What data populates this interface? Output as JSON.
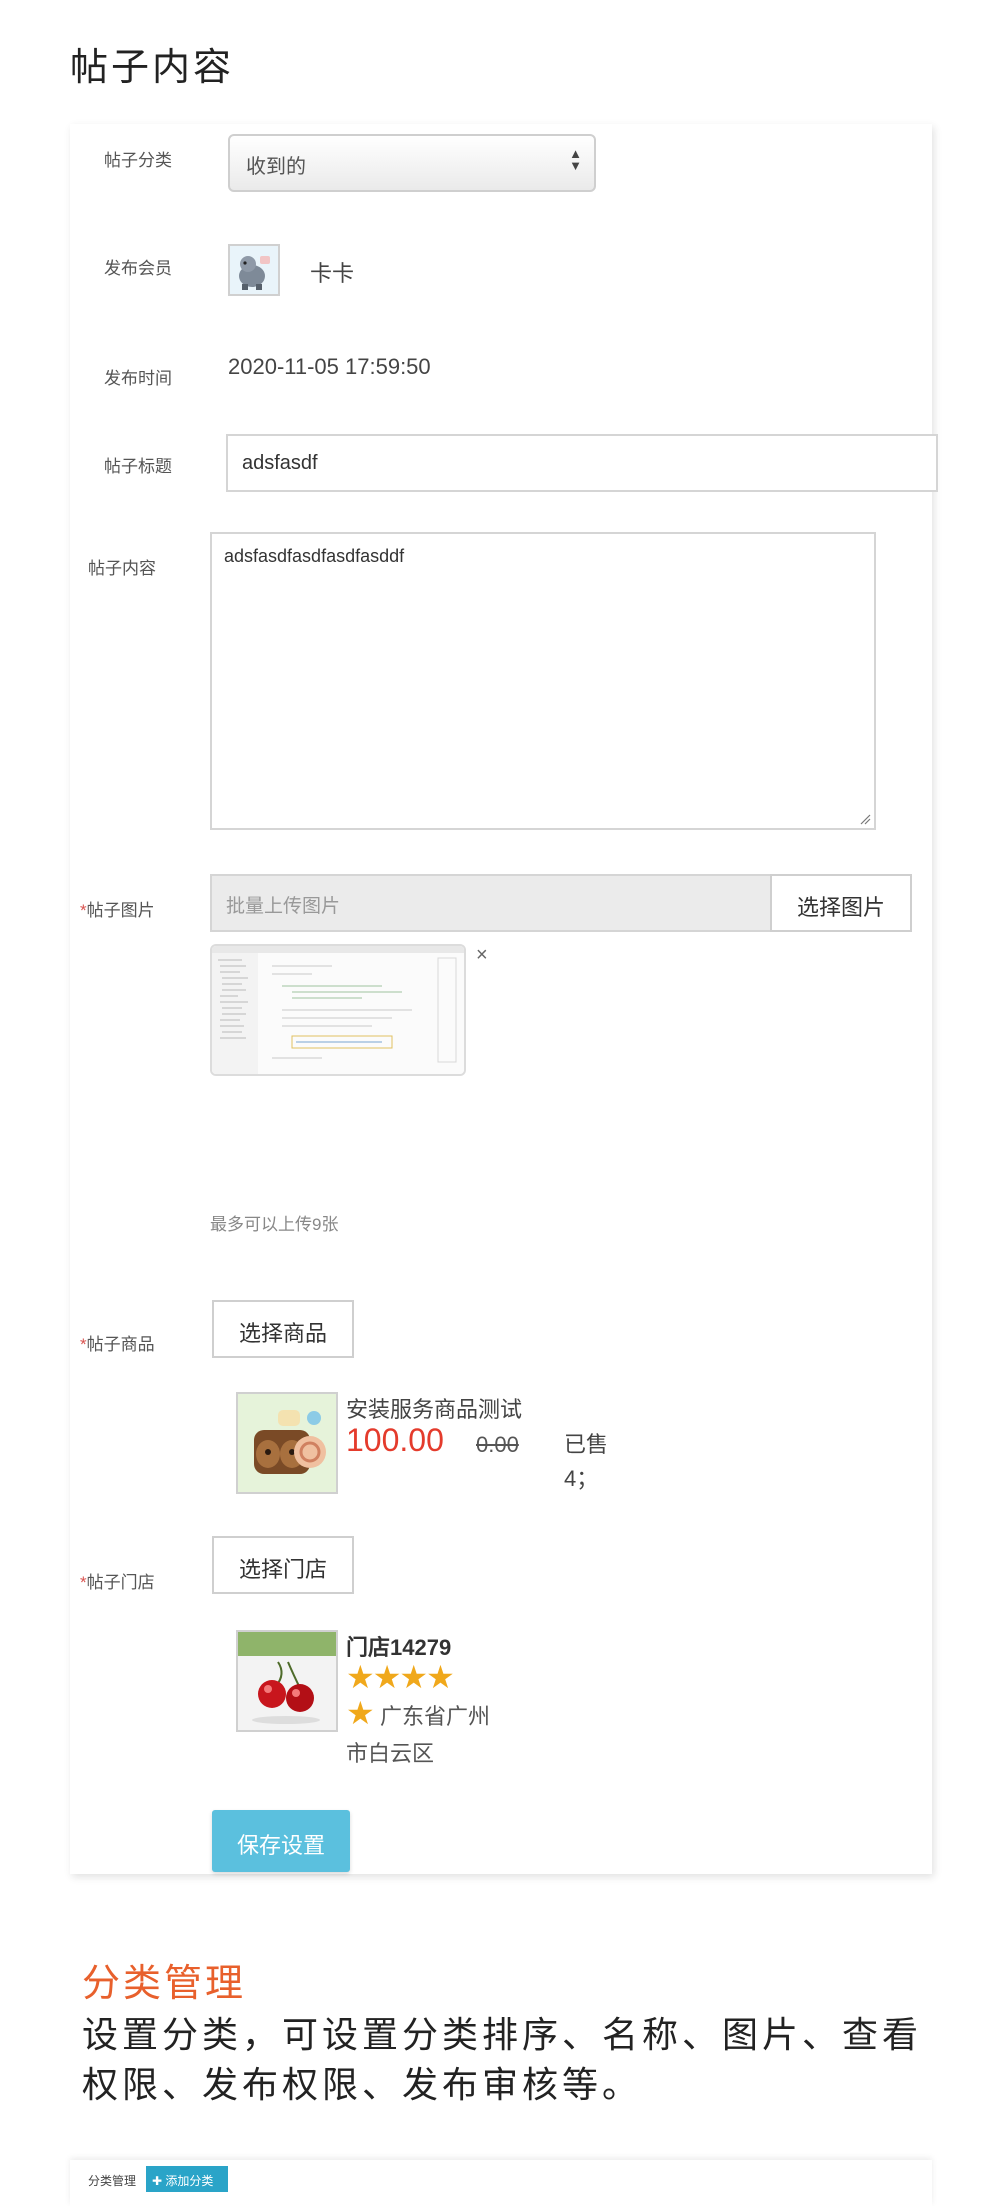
{
  "page": {
    "title": "帖子内容"
  },
  "form": {
    "category": {
      "label": "帖子分类",
      "value": "收到的"
    },
    "member": {
      "label": "发布会员",
      "name": "卡卡"
    },
    "publish_time": {
      "label": "发布时间",
      "value": "2020-11-05 17:59:50"
    },
    "post_title": {
      "label": "帖子标题",
      "value": "adsfasdf"
    },
    "post_content": {
      "label": "帖子内容",
      "value": "adsfasdfasdfasdfasddf"
    },
    "post_images": {
      "required_mark": "*",
      "label": "帖子图片",
      "placeholder": "批量上传图片",
      "button": "选择图片",
      "remove_glyph": "×",
      "hint": "最多可以上传9张"
    },
    "post_goods": {
      "required_mark": "*",
      "label": "帖子商品",
      "button": "选择商品",
      "item": {
        "name": "安装服务商品测试",
        "price": "100.00",
        "old_price": "0.00",
        "sold": "已售4；"
      }
    },
    "post_store": {
      "required_mark": "*",
      "label": "帖子门店",
      "button": "选择门店",
      "item": {
        "name": "门店14279",
        "rating_stars": 5,
        "address_line1": "广东省广州",
        "address_line2": "市白云区"
      }
    },
    "save_button": "保存设置"
  },
  "section": {
    "title": "分类管理",
    "description": "设置分类，可设置分类排序、名称、图片、查看权限、发布权限、发布审核等。"
  },
  "mini_preview": {
    "label": "分类管理",
    "add_button": "✚ 添加分类"
  },
  "colors": {
    "accent": "#5bc0de",
    "price": "#e43b2c",
    "star": "#f0a81b",
    "section_title": "#e8602c"
  }
}
